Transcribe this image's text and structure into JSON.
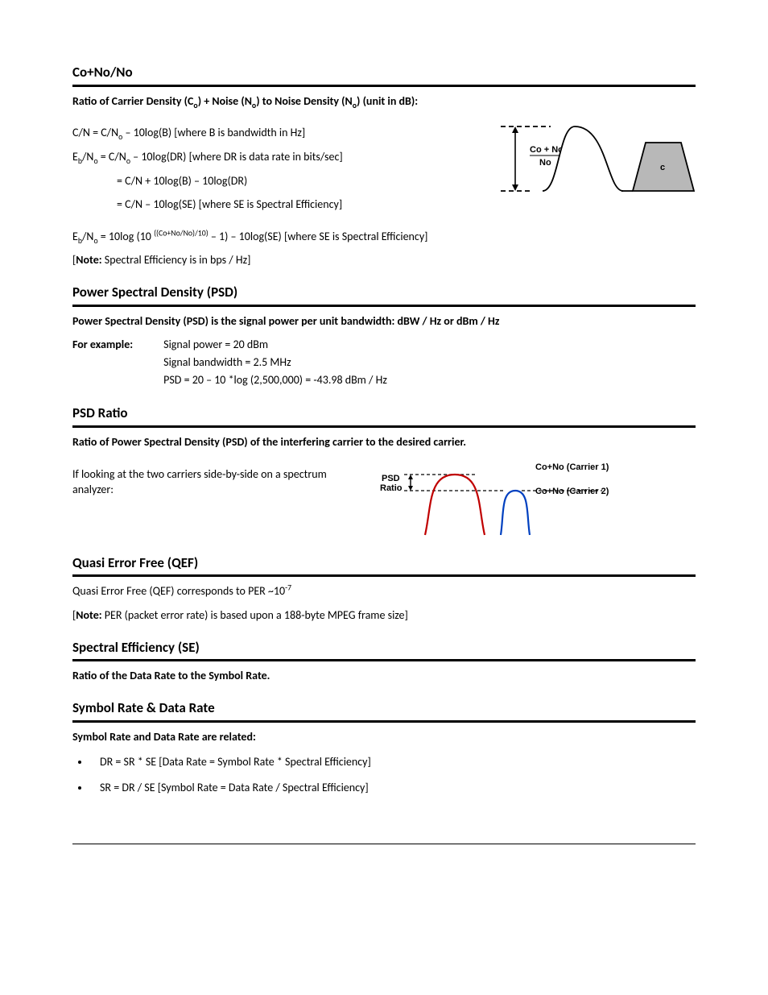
{
  "sec1": {
    "title": "Co+No/No",
    "defn": "Ratio of Carrier Density (C<sub>o</sub>) + Noise (N<sub>o</sub>) to Noise Density (N<sub>o</sub>) (unit in dB):",
    "eq1": "C/N = C/N<sub>o</sub> – 10log(B) [where B is bandwidth in Hz]",
    "eq2": "E<sub>b</sub>/N<sub>o</sub> = C/N<sub>o</sub> – 10log(DR) [where DR is data rate in bits/sec]",
    "eq3": "= C/N + 10log(B) – 10log(DR)",
    "eq4": "= C/N – 10log(SE) [where SE is Spectral Efficiency]",
    "eq5": "E<sub>b</sub>/N<sub>o</sub> = 10log (10 <sup>((Co+No/No)/10)</sup> – 1) – 10log(SE) [where SE is Spectral Efficiency]",
    "note": "[<b>Note:</b> Spectral Efficiency is in bps / Hz]",
    "fig": {
      "top": "Co + No",
      "bot": "No",
      "c": "c"
    }
  },
  "sec2": {
    "title": "Power Spectral Density (PSD)",
    "defn": "Power Spectral Density (PSD) is the signal power per unit bandwidth: dBW / Hz or dBm / Hz",
    "example_label": "For example:",
    "ex1": "Signal power = 20 dBm",
    "ex2": "Signal bandwidth = 2.5 MHz",
    "ex3": "PSD = 20 – 10 *log (2,500,000) = -43.98 dBm / Hz"
  },
  "sec3": {
    "title": "PSD Ratio",
    "defn": "Ratio of Power Spectral Density (PSD) of the interfering carrier to the desired carrier.",
    "body": "If looking at the two carriers side-by-side on a spectrum analyzer:",
    "fig": {
      "psd": "PSD",
      "ratio": "Ratio",
      "c1": "Co+No (Carrier 1)",
      "c2": "Co+No (Carrier 2)"
    }
  },
  "sec4": {
    "title": "Quasi Error Free (QEF)",
    "body": "Quasi Error Free (QEF) corresponds to PER ~10<sup>-7</sup>",
    "note": "[<b>Note:</b> PER (packet error rate) is based upon a 188-byte MPEG frame size]"
  },
  "sec5": {
    "title": "Spectral Efficiency (SE)",
    "defn": "Ratio of the Data Rate to the Symbol Rate."
  },
  "sec6": {
    "title": "Symbol Rate & Data Rate",
    "defn": "Symbol Rate and Data Rate are related:",
    "b1": "DR = SR * SE [Data Rate = Symbol Rate * Spectral Efficiency]",
    "b2": "SR = DR / SE [Symbol Rate = Data Rate / Spectral Efficiency]"
  }
}
